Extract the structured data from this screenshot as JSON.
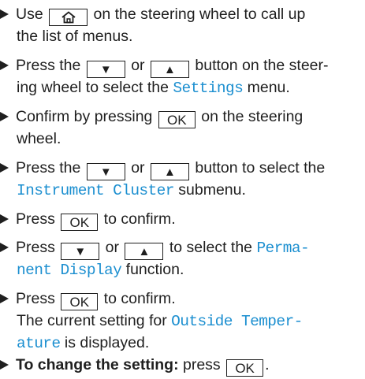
{
  "steps": {
    "s1": {
      "pre": "Use ",
      "post": " on the steering wheel to call up",
      "line2": "the list of menus."
    },
    "s2": {
      "pre": "Press the ",
      "mid": " or ",
      "post": " button on the steer-",
      "line2pre": "ing wheel to select the ",
      "menu": "Settings",
      "line2post": " menu."
    },
    "s3": {
      "pre": "Confirm by pressing ",
      "post": " on the steering",
      "line2": "wheel."
    },
    "s4": {
      "pre": "Press the ",
      "mid": " or ",
      "post": " button to select the",
      "menu": "Instrument Cluster",
      "line2post": " submenu."
    },
    "s5": {
      "pre": "Press ",
      "post": " to confirm."
    },
    "s6": {
      "pre": "Press ",
      "mid": " or ",
      "post": " to select the ",
      "menu1": "Perma-",
      "menu2": "nent Display",
      "line2post": " function."
    },
    "s7": {
      "pre": "Press ",
      "post": " to confirm.",
      "line2": "The current setting for ",
      "menu1": "Outside Temper-",
      "menu2": "ature",
      "line3post": " is displayed."
    },
    "s8": {
      "bold": "To change the setting:",
      "post": " press "
    }
  },
  "keys": {
    "home": "⌂",
    "down": "▼",
    "up": "▲",
    "ok": "OK"
  },
  "icons": {
    "home": "home-icon",
    "down": "down-arrow-icon",
    "up": "up-arrow-icon"
  }
}
